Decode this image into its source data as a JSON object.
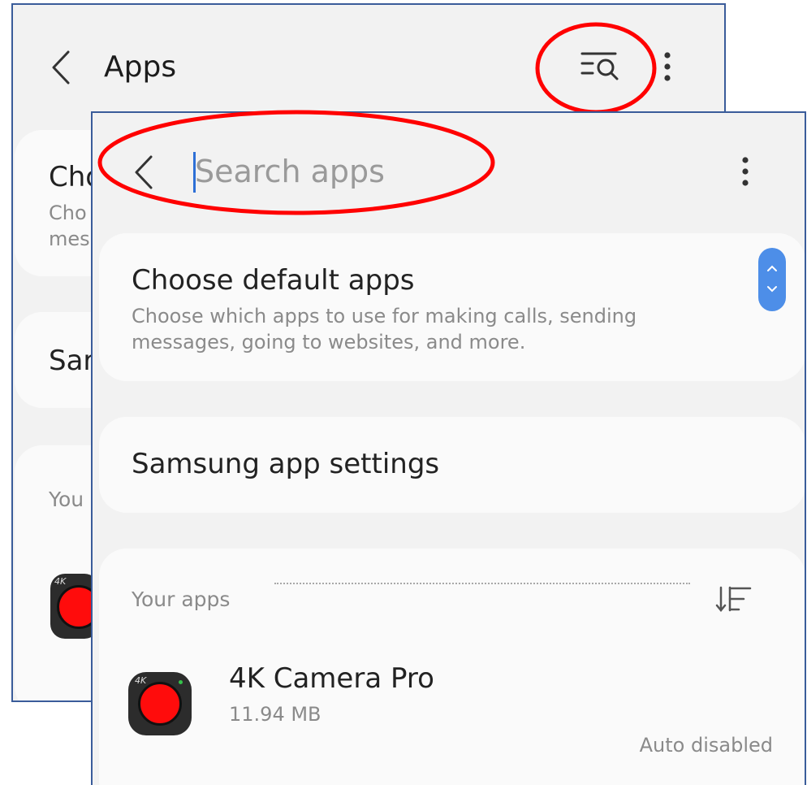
{
  "back_screen": {
    "title": "Apps",
    "card1_title": "Cho",
    "card1_sub_line1": "Cho",
    "card1_sub_line2": "mes",
    "card2_title": "Sar",
    "section_label": "You",
    "app_icon_badge": "4K"
  },
  "search_screen": {
    "search_placeholder": "Search apps",
    "choose_default": {
      "title": "Choose default apps",
      "sub_line1": "Choose which apps to use for making calls, sending",
      "sub_line2": "messages, going to websites, and more."
    },
    "samsung_settings": {
      "title": "Samsung app settings"
    },
    "your_apps": {
      "label": "Your apps",
      "apps": [
        {
          "name": "4K Camera Pro",
          "size": "11.94 MB",
          "status": "Auto disabled",
          "icon_badge": "4K"
        }
      ]
    }
  },
  "colors": {
    "annotation_red": "#ff0000",
    "accent_blue": "#4d8ee8",
    "frame_border": "#3a5c9a"
  },
  "icons": [
    "back-arrow-icon",
    "search-filter-icon",
    "more-options-icon",
    "chevron-up-icon",
    "chevron-down-icon",
    "sort-icon",
    "camera-app-icon"
  ]
}
